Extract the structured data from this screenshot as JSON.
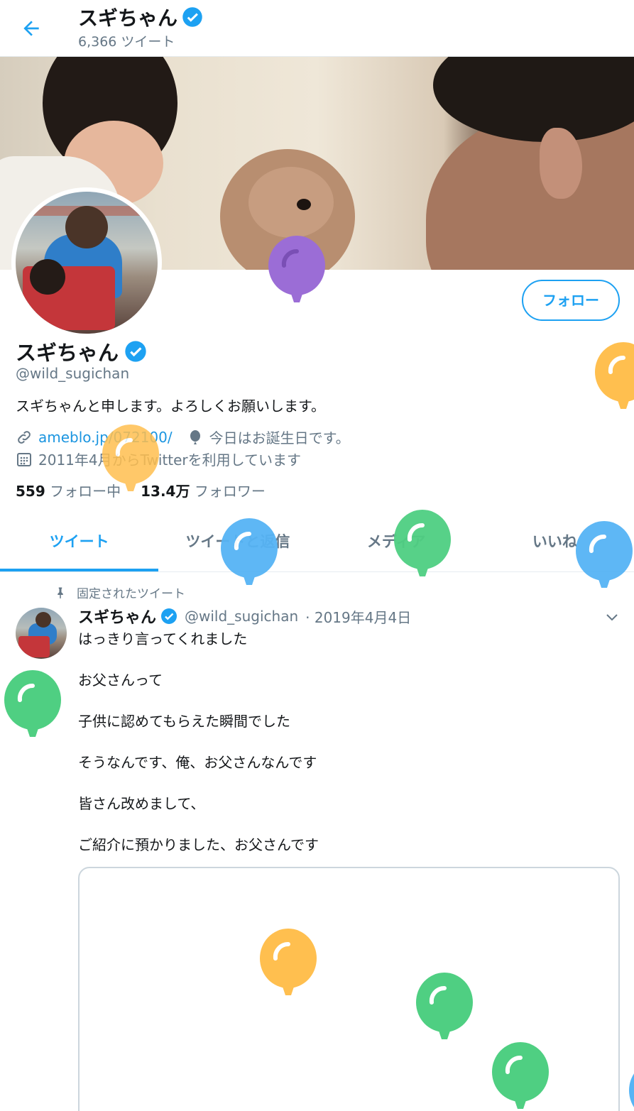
{
  "header": {
    "name": "スギちゃん",
    "tweet_count": "6,366 ツイート"
  },
  "profile": {
    "name": "スギちゃん",
    "handle": "@wild_sugichan",
    "bio": "スギちゃんと申します。よろしくお願いします。",
    "link": "ameblo.jp/072100/",
    "birthday_text": "今日はお誕生日です。",
    "joined": "2011年4月からTwitterを利用しています",
    "follow_button": "フォロー",
    "following_count": "559",
    "following_label": "フォロー中",
    "followers_count": "13.4万",
    "followers_label": "フォロワー"
  },
  "tabs": [
    {
      "label": "ツイート",
      "active": true
    },
    {
      "label": "ツイートと返信",
      "active": false
    },
    {
      "label": "メディア",
      "active": false
    },
    {
      "label": "いいね",
      "active": false
    }
  ],
  "pinned_tweet": {
    "pinned_label": "固定されたツイート",
    "name": "スギちゃん",
    "handle": "@wild_sugichan",
    "date": "· 2019年4月4日",
    "lines": [
      "はっきり言ってくれました",
      "お父さんって",
      "子供に認めてもらえた瞬間でした",
      "そうなんです、俺、お父さんなんです",
      "皆さん改めまして、",
      "ご紹介に預かりました、お父さんです"
    ]
  },
  "colors": {
    "accent": "#1da1f2",
    "verified": "#1da1f2",
    "balloon_purple": "#9b6dd6",
    "balloon_orange": "#ffbf4f",
    "balloon_blue": "#56b4f5",
    "balloon_green": "#4fcf82"
  },
  "icons": [
    "back-arrow-icon",
    "verified-badge-icon",
    "link-icon",
    "balloon-icon",
    "calendar-icon",
    "pin-icon",
    "chevron-down-icon"
  ]
}
